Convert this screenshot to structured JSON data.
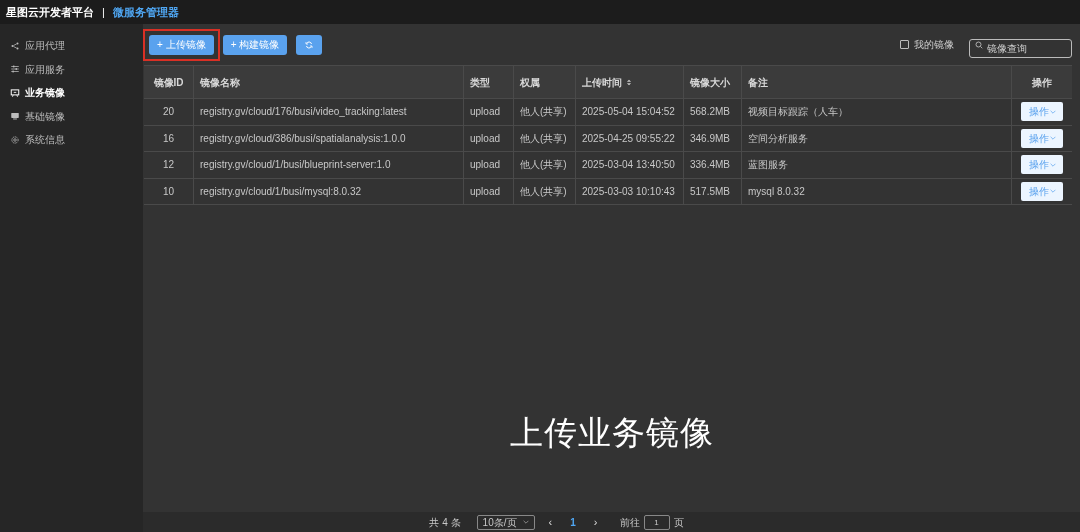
{
  "header": {
    "title": "星图云开发者平台",
    "separator": "|",
    "subtitle": "微服务管理器"
  },
  "sidebar": {
    "items": [
      {
        "label": "应用代理",
        "selected": false
      },
      {
        "label": "应用服务",
        "selected": false
      },
      {
        "label": "业务镜像",
        "selected": true
      },
      {
        "label": "基础镜像",
        "selected": false
      },
      {
        "label": "系统信息",
        "selected": false
      }
    ]
  },
  "toolbar": {
    "buttons": [
      {
        "kind": "text",
        "label": "上传镜像",
        "icon": "+",
        "highlighted": true
      },
      {
        "kind": "text",
        "label": "构建镜像",
        "icon": "+"
      },
      {
        "kind": "refresh"
      }
    ],
    "my_images": {
      "label": "我的镜像",
      "checked": false
    },
    "search": {
      "placeholder": "镜像查询"
    }
  },
  "table": {
    "columns": [
      "镜像ID",
      "镜像名称",
      "类型",
      "权属",
      "上传时间",
      "镜像大小",
      "备注",
      "操作"
    ],
    "rows": [
      {
        "id": "20",
        "name": "registry.gv/cloud/176/busi/video_tracking:latest",
        "type": "upload",
        "owner": "他人(共享)",
        "time": "2025-05-04 15:04:52",
        "size": "568.2MB",
        "remark": "视频目标跟踪（人车）",
        "action": "操作"
      },
      {
        "id": "16",
        "name": "registry.gv/cloud/386/busi/spatialanalysis:1.0.0",
        "type": "upload",
        "owner": "他人(共享)",
        "time": "2025-04-25 09:55:22",
        "size": "346.9MB",
        "remark": "空间分析服务",
        "action": "操作"
      },
      {
        "id": "12",
        "name": "registry.gv/cloud/1/busi/blueprint-server:1.0",
        "type": "upload",
        "owner": "他人(共享)",
        "time": "2025-03-04 13:40:50",
        "size": "336.4MB",
        "remark": "蓝图服务",
        "action": "操作"
      },
      {
        "id": "10",
        "name": "registry.gv/cloud/1/busi/mysql:8.0.32",
        "type": "upload",
        "owner": "他人(共享)",
        "time": "2025-03-03 10:10:43",
        "size": "517.5MB",
        "remark": "mysql 8.0.32",
        "action": "操作"
      }
    ]
  },
  "caption": "上传业务镜像",
  "pagination": {
    "total": "共 4 条",
    "page_size": "10条/页",
    "prev": "‹",
    "current": "1",
    "next": "›",
    "goto_label": "前往",
    "goto_value": "1",
    "goto_suffix": "页"
  }
}
